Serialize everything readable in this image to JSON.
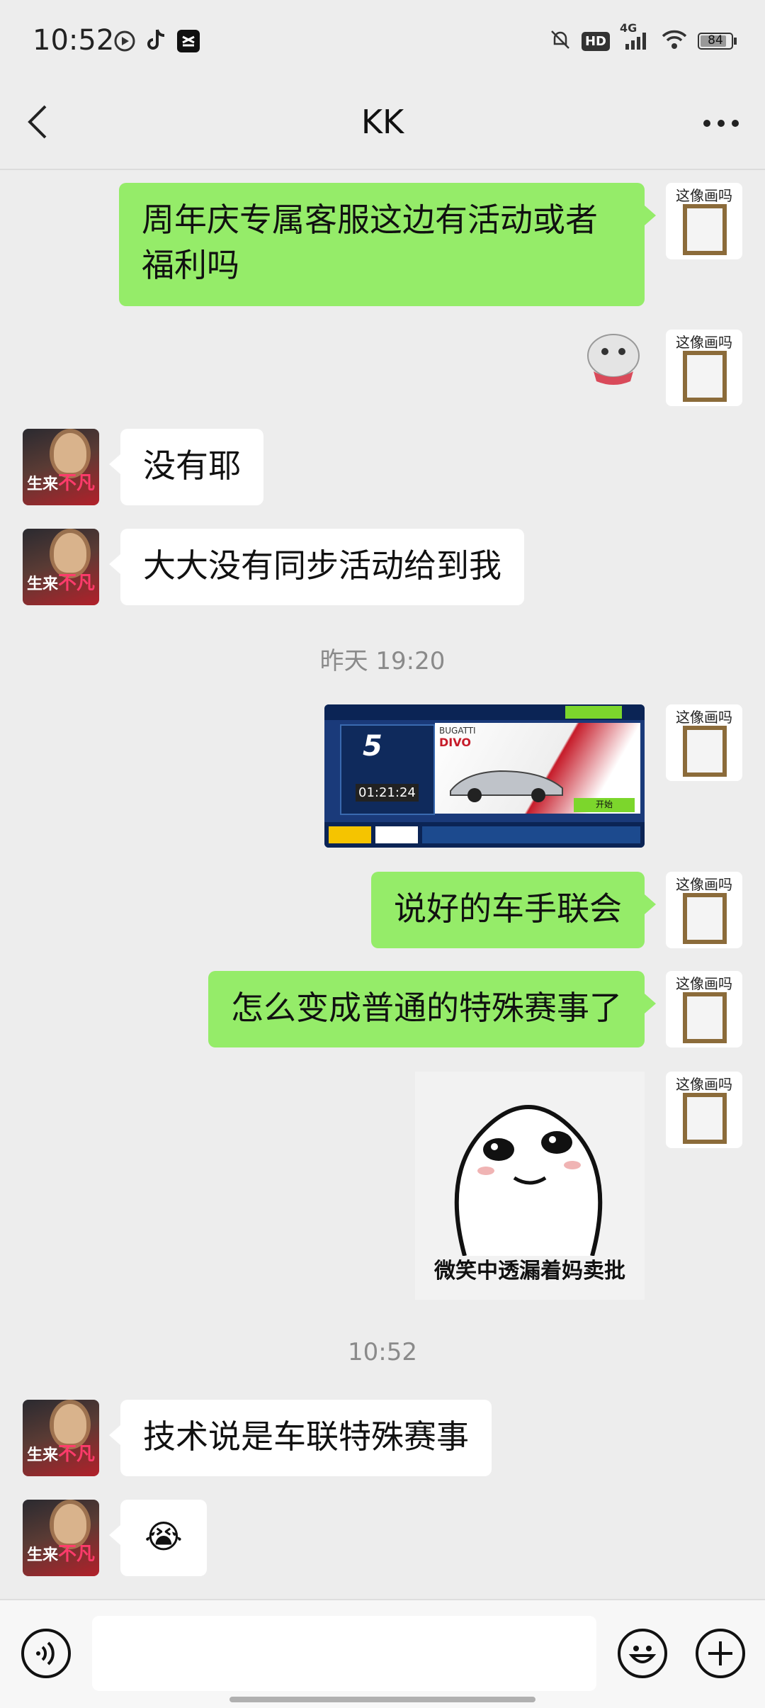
{
  "status_bar": {
    "time": "10:52",
    "battery": "84",
    "network": "4G"
  },
  "header": {
    "title": "KK"
  },
  "my_avatar_caption": "这像画吗",
  "messages": {
    "m1": "周年庆专属客服这边有活动或者福利吗",
    "m3": "没有耶",
    "m4": "大大没有同步活动给到我",
    "m6": "说好的车手联会",
    "m7": "怎么变成普通的特殊赛事了",
    "m8_caption": "微笑中透漏着妈卖批",
    "m9": "技术说是车联特殊赛事",
    "m10_emoji": "😭"
  },
  "game_screenshot": {
    "brand": "BUGATTI",
    "model": "DIVO",
    "level": "5",
    "timer": "01:21:24",
    "start_button": "开始"
  },
  "timestamps": {
    "t1": "昨天 19:20",
    "t2": "10:52"
  },
  "kk_avatar_text": {
    "a": "生来",
    "b": "不凡"
  },
  "colors": {
    "green_bubble": "#95ec69",
    "background": "#ededed"
  }
}
